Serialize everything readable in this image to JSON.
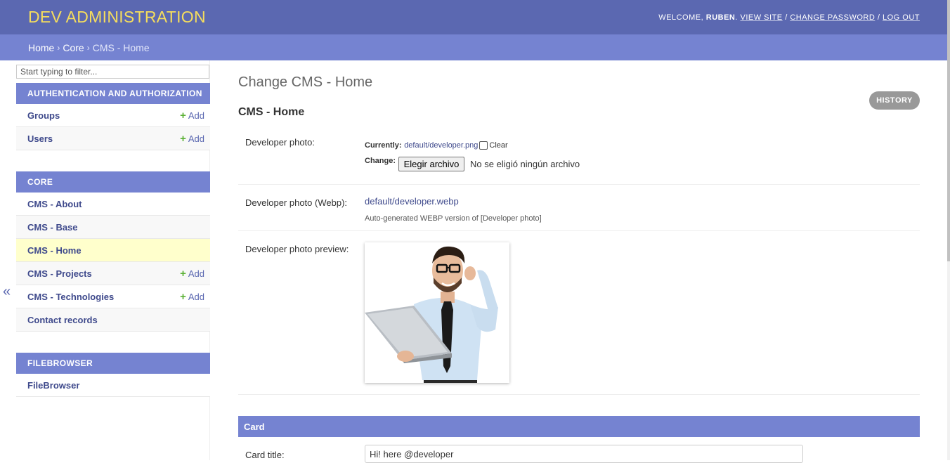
{
  "header": {
    "site_title": "DEV ADMINISTRATION",
    "welcome": "WELCOME,",
    "username": "RUBEN",
    "view_site": "VIEW SITE",
    "change_password": "CHANGE PASSWORD",
    "log_out": "LOG OUT",
    "separator": "/"
  },
  "breadcrumbs": {
    "home": "Home",
    "app": "Core",
    "current": "CMS - Home",
    "separator": "›"
  },
  "sidebar": {
    "filter_placeholder": "Start typing to filter...",
    "collapse_glyph": "«",
    "add_label": "Add",
    "plus_glyph": "+",
    "modules": [
      {
        "caption": "Authentication and Authorization",
        "models": [
          {
            "label": "Groups",
            "add": true
          },
          {
            "label": "Users",
            "add": true
          }
        ]
      },
      {
        "caption": "Core",
        "models": [
          {
            "label": "CMS - About",
            "add": false
          },
          {
            "label": "CMS - Base",
            "add": false
          },
          {
            "label": "CMS - Home",
            "add": false,
            "current": true
          },
          {
            "label": "CMS - Projects",
            "add": true
          },
          {
            "label": "CMS - Technologies",
            "add": true
          },
          {
            "label": "Contact records",
            "add": false
          }
        ]
      },
      {
        "caption": "Filebrowser",
        "models": [
          {
            "label": "FileBrowser",
            "add": false
          }
        ]
      }
    ]
  },
  "content": {
    "page_title": "Change CMS - Home",
    "history": "History",
    "object_heading": "CMS - Home",
    "developer_photo": {
      "label": "Developer photo:",
      "currently_label": "Currently:",
      "currently_value": "default/developer.png",
      "clear_label": "Clear",
      "change_label": "Change:",
      "choose_button": "Elegir archivo",
      "no_file": "No se eligió ningún archivo"
    },
    "developer_photo_webp": {
      "label": "Developer photo (Webp):",
      "value": "default/developer.webp",
      "help": "Auto-generated WEBP version of [Developer photo]"
    },
    "developer_photo_preview": {
      "label": "Developer photo preview:"
    },
    "card": {
      "caption": "Card",
      "title_label": "Card title:",
      "title_value": "Hi! here @developer"
    }
  },
  "colors": {
    "header_bg": "#5b68b1",
    "breadcrumb_bg": "#7583d1",
    "title_color": "#f5dd5d",
    "link_color": "#3f4a8c",
    "add_plus": "#5ab034",
    "current_row_bg": "#ffffcc"
  }
}
